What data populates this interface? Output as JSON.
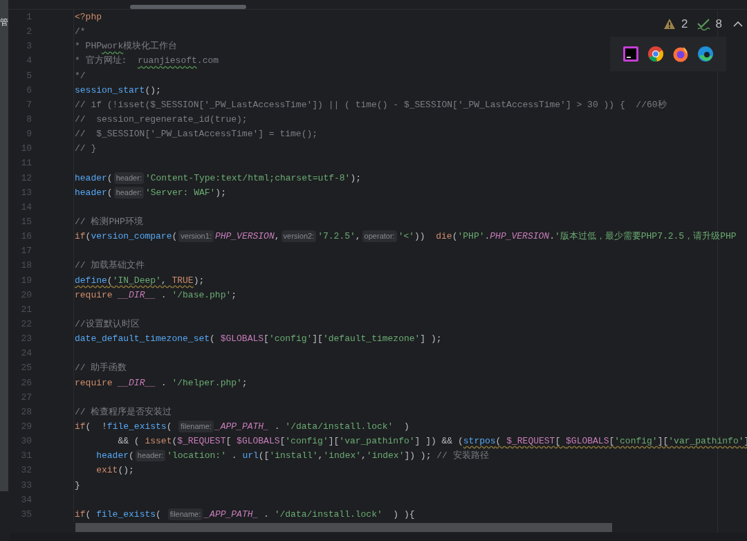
{
  "side_strip": {
    "label": "管"
  },
  "inspections": {
    "warnings": "2",
    "weak_warnings": "8"
  },
  "lines": [
    {
      "number": "1",
      "tokens": [
        {
          "kind": "kw",
          "text": "<?php"
        }
      ]
    },
    {
      "number": "2",
      "tokens": [
        {
          "kind": "cm",
          "text": "/*"
        }
      ]
    },
    {
      "number": "3",
      "tokens": [
        {
          "kind": "cm",
          "text": "* PHP"
        },
        {
          "kind": "cm",
          "text": "work",
          "misspelled": true
        },
        {
          "kind": "cm",
          "text": "模块化工作台"
        }
      ]
    },
    {
      "number": "4",
      "tokens": [
        {
          "kind": "cm",
          "text": "* 官方网址:  "
        },
        {
          "kind": "cm",
          "text": "ruanjiesoft",
          "misspelled": true
        },
        {
          "kind": "cm",
          "text": ".com"
        }
      ]
    },
    {
      "number": "5",
      "tokens": [
        {
          "kind": "cm",
          "text": "*/"
        }
      ]
    },
    {
      "number": "6",
      "tokens": [
        {
          "kind": "fn",
          "text": "session_start"
        },
        {
          "kind": "p",
          "text": "();"
        }
      ]
    },
    {
      "number": "7",
      "tokens": [
        {
          "kind": "cm",
          "text": "// if (!isset($_SESSION['_PW_LastAccessTime']) || ( time() - $_SESSION['_PW_LastAccessTime'] > 30 )) {  //60秒"
        }
      ]
    },
    {
      "number": "8",
      "tokens": [
        {
          "kind": "cm",
          "text": "//  session_regenerate_id(true);"
        }
      ]
    },
    {
      "number": "9",
      "tokens": [
        {
          "kind": "cm",
          "text": "//  $_SESSION['_PW_LastAccessTime'] = time();"
        }
      ]
    },
    {
      "number": "10",
      "tokens": [
        {
          "kind": "cm",
          "text": "// }"
        }
      ]
    },
    {
      "number": "11"
    },
    {
      "number": "12",
      "tokens": [
        {
          "kind": "fn",
          "text": "header"
        },
        {
          "kind": "p",
          "text": "("
        },
        {
          "kind": "hint",
          "text": "header:"
        },
        {
          "kind": "str",
          "text": "'Content-Type:text/html;charset=utf-8'"
        },
        {
          "kind": "p",
          "text": ");"
        }
      ]
    },
    {
      "number": "13",
      "tokens": [
        {
          "kind": "fn",
          "text": "header"
        },
        {
          "kind": "p",
          "text": "("
        },
        {
          "kind": "hint",
          "text": "header:"
        },
        {
          "kind": "str",
          "text": "'Server: WAF'"
        },
        {
          "kind": "p",
          "text": ");"
        }
      ]
    },
    {
      "number": "14"
    },
    {
      "number": "15",
      "tokens": [
        {
          "kind": "cm",
          "text": "// 检测PHP环境"
        }
      ]
    },
    {
      "number": "16",
      "tokens": [
        {
          "kind": "kw",
          "text": "if"
        },
        {
          "kind": "p",
          "text": "("
        },
        {
          "kind": "fn",
          "text": "version_compare"
        },
        {
          "kind": "p",
          "text": "("
        },
        {
          "kind": "hint",
          "text": "version1:"
        },
        {
          "kind": "const",
          "text": "PHP_VERSION"
        },
        {
          "kind": "p",
          "text": ","
        },
        {
          "kind": "hint",
          "text": "version2:"
        },
        {
          "kind": "str",
          "text": "'7.2.5'"
        },
        {
          "kind": "p",
          "text": ","
        },
        {
          "kind": "hint",
          "text": "operator:"
        },
        {
          "kind": "str",
          "text": "'<'"
        },
        {
          "kind": "p",
          "text": "))  "
        },
        {
          "kind": "kw",
          "text": "die"
        },
        {
          "kind": "p",
          "text": "("
        },
        {
          "kind": "str",
          "text": "'PHP'"
        },
        {
          "kind": "p",
          "text": "."
        },
        {
          "kind": "const",
          "text": "PHP_VERSION"
        },
        {
          "kind": "p",
          "text": "."
        },
        {
          "kind": "str",
          "text": "'版本过低，最少需要PHP7.2.5，请升级PHP"
        }
      ]
    },
    {
      "number": "17"
    },
    {
      "number": "18",
      "tokens": [
        {
          "kind": "cm",
          "text": "// 加载基础文件"
        }
      ]
    },
    {
      "number": "19",
      "tokens": [
        {
          "kind": "fn",
          "text": "define",
          "warned": true
        },
        {
          "kind": "p",
          "text": "(",
          "warned": true
        },
        {
          "kind": "str",
          "text": "'IN_Deep'",
          "warned": true
        },
        {
          "kind": "p",
          "text": ", ",
          "warned": true
        },
        {
          "kind": "kw",
          "text": "TRUE",
          "warned": true
        },
        {
          "kind": "p",
          "text": ");"
        }
      ]
    },
    {
      "number": "20",
      "tokens": [
        {
          "kind": "kw",
          "text": "require "
        },
        {
          "kind": "const",
          "text": "__DIR__"
        },
        {
          "kind": "p",
          "text": " . "
        },
        {
          "kind": "str",
          "text": "'/base.php'"
        },
        {
          "kind": "p",
          "text": ";"
        }
      ]
    },
    {
      "number": "21"
    },
    {
      "number": "22",
      "tokens": [
        {
          "kind": "cm",
          "text": "//设置默认时区"
        }
      ]
    },
    {
      "number": "23",
      "tokens": [
        {
          "kind": "fn",
          "text": "date_default_timezone_set"
        },
        {
          "kind": "p",
          "text": "( "
        },
        {
          "kind": "var",
          "text": "$GLOBALS"
        },
        {
          "kind": "p",
          "text": "["
        },
        {
          "kind": "str",
          "text": "'config'"
        },
        {
          "kind": "p",
          "text": "]["
        },
        {
          "kind": "str",
          "text": "'default_timezone'"
        },
        {
          "kind": "p",
          "text": "] );"
        }
      ]
    },
    {
      "number": "24"
    },
    {
      "number": "25",
      "tokens": [
        {
          "kind": "cm",
          "text": "// 助手函数"
        }
      ]
    },
    {
      "number": "26",
      "tokens": [
        {
          "kind": "kw",
          "text": "require "
        },
        {
          "kind": "const",
          "text": "__DIR__"
        },
        {
          "kind": "p",
          "text": " . "
        },
        {
          "kind": "str",
          "text": "'/helper.php'"
        },
        {
          "kind": "p",
          "text": ";"
        }
      ]
    },
    {
      "number": "27"
    },
    {
      "number": "28",
      "tokens": [
        {
          "kind": "cm",
          "text": "// 检查程序是否安装过"
        }
      ]
    },
    {
      "number": "29",
      "tokens": [
        {
          "kind": "kw",
          "text": "if"
        },
        {
          "kind": "p",
          "text": "(  !"
        },
        {
          "kind": "fn",
          "text": "file_exists"
        },
        {
          "kind": "p",
          "text": "( "
        },
        {
          "kind": "hint",
          "text": "filename:"
        },
        {
          "kind": "const",
          "text": "_APP_PATH_"
        },
        {
          "kind": "p",
          "text": " . "
        },
        {
          "kind": "str",
          "text": "'/data/install.lock'"
        },
        {
          "kind": "p",
          "text": "  )"
        }
      ]
    },
    {
      "number": "30",
      "tokens": [
        {
          "kind": "p",
          "text": "        && ( "
        },
        {
          "kind": "kw",
          "text": "isset"
        },
        {
          "kind": "p",
          "text": "("
        },
        {
          "kind": "var",
          "text": "$_REQUEST"
        },
        {
          "kind": "p",
          "text": "[ "
        },
        {
          "kind": "var",
          "text": "$GLOBALS"
        },
        {
          "kind": "p",
          "text": "["
        },
        {
          "kind": "str",
          "text": "'config'"
        },
        {
          "kind": "p",
          "text": "]["
        },
        {
          "kind": "str",
          "text": "'var_pathinfo'"
        },
        {
          "kind": "p",
          "text": "] ]) && ("
        },
        {
          "kind": "fn",
          "text": "strpos",
          "warned": true
        },
        {
          "kind": "p",
          "text": "( ",
          "warned": true
        },
        {
          "kind": "var",
          "text": "$_REQUEST",
          "warned": true
        },
        {
          "kind": "p",
          "text": "[ ",
          "warned": true
        },
        {
          "kind": "var",
          "text": "$GLOBALS",
          "warned": true
        },
        {
          "kind": "p",
          "text": "[",
          "warned": true
        },
        {
          "kind": "str",
          "text": "'config'",
          "warned": true
        },
        {
          "kind": "p",
          "text": "][",
          "warned": true
        },
        {
          "kind": "str",
          "text": "'var_pathinfo'",
          "warned": true
        },
        {
          "kind": "p",
          "text": "]",
          "warned": true
        }
      ]
    },
    {
      "number": "31",
      "tokens": [
        {
          "kind": "fn",
          "text": "    header"
        },
        {
          "kind": "p",
          "text": "("
        },
        {
          "kind": "hint",
          "text": "header:"
        },
        {
          "kind": "str",
          "text": "'location:'"
        },
        {
          "kind": "p",
          "text": " . "
        },
        {
          "kind": "fn",
          "text": "url"
        },
        {
          "kind": "p",
          "text": "(["
        },
        {
          "kind": "str",
          "text": "'install'"
        },
        {
          "kind": "p",
          "text": ","
        },
        {
          "kind": "str",
          "text": "'index'"
        },
        {
          "kind": "p",
          "text": ","
        },
        {
          "kind": "str",
          "text": "'index'"
        },
        {
          "kind": "p",
          "text": "]) ); "
        },
        {
          "kind": "cm",
          "text": "// 安装路径"
        }
      ]
    },
    {
      "number": "32",
      "tokens": [
        {
          "kind": "kw",
          "text": "    exit"
        },
        {
          "kind": "p",
          "text": "();"
        }
      ]
    },
    {
      "number": "33",
      "tokens": [
        {
          "kind": "p",
          "text": "}"
        }
      ]
    },
    {
      "number": "34"
    },
    {
      "number": "35",
      "tokens": [
        {
          "kind": "kw",
          "text": "if"
        },
        {
          "kind": "p",
          "text": "( "
        },
        {
          "kind": "fn",
          "text": "file_exists"
        },
        {
          "kind": "p",
          "text": "( "
        },
        {
          "kind": "hint",
          "text": "filename:"
        },
        {
          "kind": "const",
          "text": "_APP_PATH_"
        },
        {
          "kind": "p",
          "text": " . "
        },
        {
          "kind": "str",
          "text": "'/data/install.lock'"
        },
        {
          "kind": "p",
          "text": "  ) ){"
        }
      ]
    }
  ]
}
